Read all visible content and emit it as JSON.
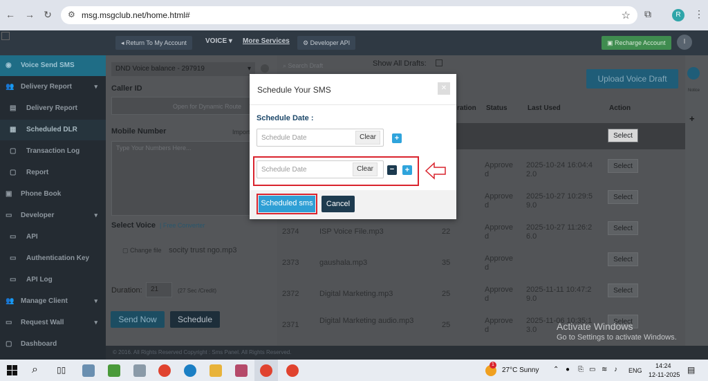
{
  "browser": {
    "url": "msg.msgclub.net/home.html#",
    "profile_initial": "R"
  },
  "header": {
    "return_btn": "Return To My Account",
    "voice_menu": "VOICE ▾",
    "more_services": "More Services",
    "developer_api": "Developer API",
    "recharge": "Recharge Account",
    "avatar": "I"
  },
  "sidebar": {
    "items": [
      {
        "label": "Voice Send SMS"
      },
      {
        "label": "Delivery Report"
      },
      {
        "label": "Delivery Report"
      },
      {
        "label": "Scheduled DLR"
      },
      {
        "label": "Transaction Log"
      },
      {
        "label": "Report"
      },
      {
        "label": "Phone Book"
      },
      {
        "label": "Developer"
      },
      {
        "label": "API"
      },
      {
        "label": "Authentication Key"
      },
      {
        "label": "API Log"
      },
      {
        "label": "Manage Client"
      },
      {
        "label": "Request Wall"
      },
      {
        "label": "Dashboard"
      }
    ]
  },
  "form": {
    "balance": "DND Voice balance - 297919",
    "caller_id_label": "Caller ID",
    "dynamic_route": "Open for Dynamic Route",
    "mobile_label": "Mobile Number",
    "import": "Import",
    "numbers_placeholder": "Type Your Numbers Here...",
    "select_voice_label": "Select Voice",
    "free_converter": "Free Converter",
    "change_file": "Change file",
    "file_name": "socity trust ngo.mp3",
    "duration_label": "Duration:",
    "duration_value": "21",
    "duration_note": "(27 Sec /Credit)",
    "send_now": "Send Now",
    "schedule": "Schedule"
  },
  "drafts": {
    "search_placeholder": "Search Draft",
    "show_all": "Show All Drafts:",
    "upload": "Upload Voice Draft",
    "columns": {
      "ration": "ration",
      "status": "Status",
      "last_used": "Last Used",
      "action": "Action"
    },
    "select_label": "Select",
    "rows": [
      {
        "id": "",
        "name": "",
        "dur": "",
        "status": "",
        "last_used": ""
      },
      {
        "id": "",
        "name": "",
        "dur": "",
        "status": "Approve\nd",
        "last_used": "2025-10-24 16:04:4\n2.0"
      },
      {
        "id": "",
        "name": "",
        "dur": "",
        "status": "Approve\nd",
        "last_used": "2025-10-27 10:29:5\n9.0"
      },
      {
        "id": "2374",
        "name": "ISP Voice File.mp3",
        "dur": "22",
        "status": "Approve\nd",
        "last_used": "2025-10-27 11:26:2\n6.0"
      },
      {
        "id": "2373",
        "name": "gaushala.mp3",
        "dur": "35",
        "status": "Approve\nd",
        "last_used": ""
      },
      {
        "id": "2372",
        "name": "Digital Marketing.mp3",
        "dur": "25",
        "status": "Approve\nd",
        "last_used": "2025-11-11 10:47:2\n9.0"
      },
      {
        "id": "2371",
        "name": "Digital Marketing audio.mp3",
        "dur": "25",
        "status": "Approve\nd",
        "last_used": "2025-11-06 10:35:1\n3.0"
      }
    ]
  },
  "rail_label": "Notice",
  "footer": "© 2016. All Rights Reserved Copyright : Sms Panel. All Rights Reserved.",
  "modal": {
    "title": "Schedule Your SMS",
    "date_label": "Schedule Date :",
    "date_placeholder": "Schedule Date",
    "clear": "Clear",
    "scheduled_sms": "Scheduled sms",
    "cancel": "Cancel"
  },
  "watermark": {
    "line1": "Activate Windows",
    "line2": "Go to Settings to activate Windows."
  },
  "taskbar": {
    "weather": "27°C  Sunny",
    "lang": "ENG",
    "time": "14:24",
    "date": "12-11-2025",
    "notif_count": "1"
  },
  "colors": {
    "modal_primary": "#2f9fd5",
    "modal_dark": "#1e3b4f",
    "highlight": "#d9232d"
  }
}
